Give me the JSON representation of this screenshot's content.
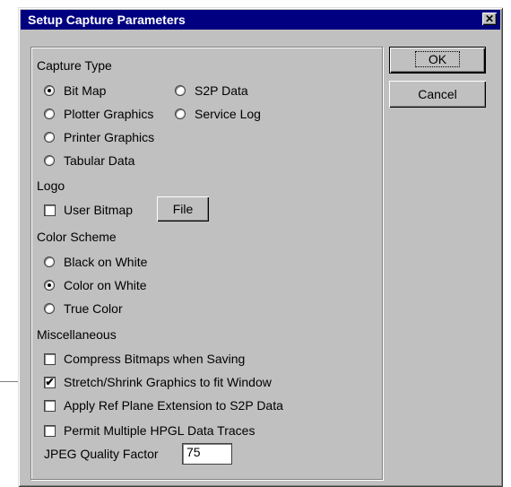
{
  "window": {
    "title": "Setup Capture Parameters",
    "close_glyph": "✕"
  },
  "buttons": {
    "ok": "OK",
    "cancel": "Cancel",
    "file": "File"
  },
  "capture_type": {
    "heading": "Capture Type",
    "options": [
      "Bit Map",
      "Plotter Graphics",
      "Printer Graphics",
      "Tabular Data",
      "S2P Data",
      "Service Log"
    ],
    "selected": "Bit Map"
  },
  "logo": {
    "heading": "Logo",
    "user_bitmap": "User Bitmap",
    "user_bitmap_checked": false
  },
  "color_scheme": {
    "heading": "Color Scheme",
    "options": [
      "Black on White",
      "Color on White",
      "True Color"
    ],
    "selected": "Color on White"
  },
  "misc": {
    "heading": "Miscellaneous",
    "items": [
      {
        "label": "Compress Bitmaps when Saving",
        "checked": false
      },
      {
        "label": "Stretch/Shrink Graphics to fit Window",
        "checked": true
      },
      {
        "label": "Apply Ref Plane Extension to S2P Data",
        "checked": false
      },
      {
        "label": "Permit Multiple HPGL Data Traces",
        "checked": false
      }
    ],
    "jpeg_label": "JPEG Quality Factor",
    "jpeg_value": "75"
  }
}
